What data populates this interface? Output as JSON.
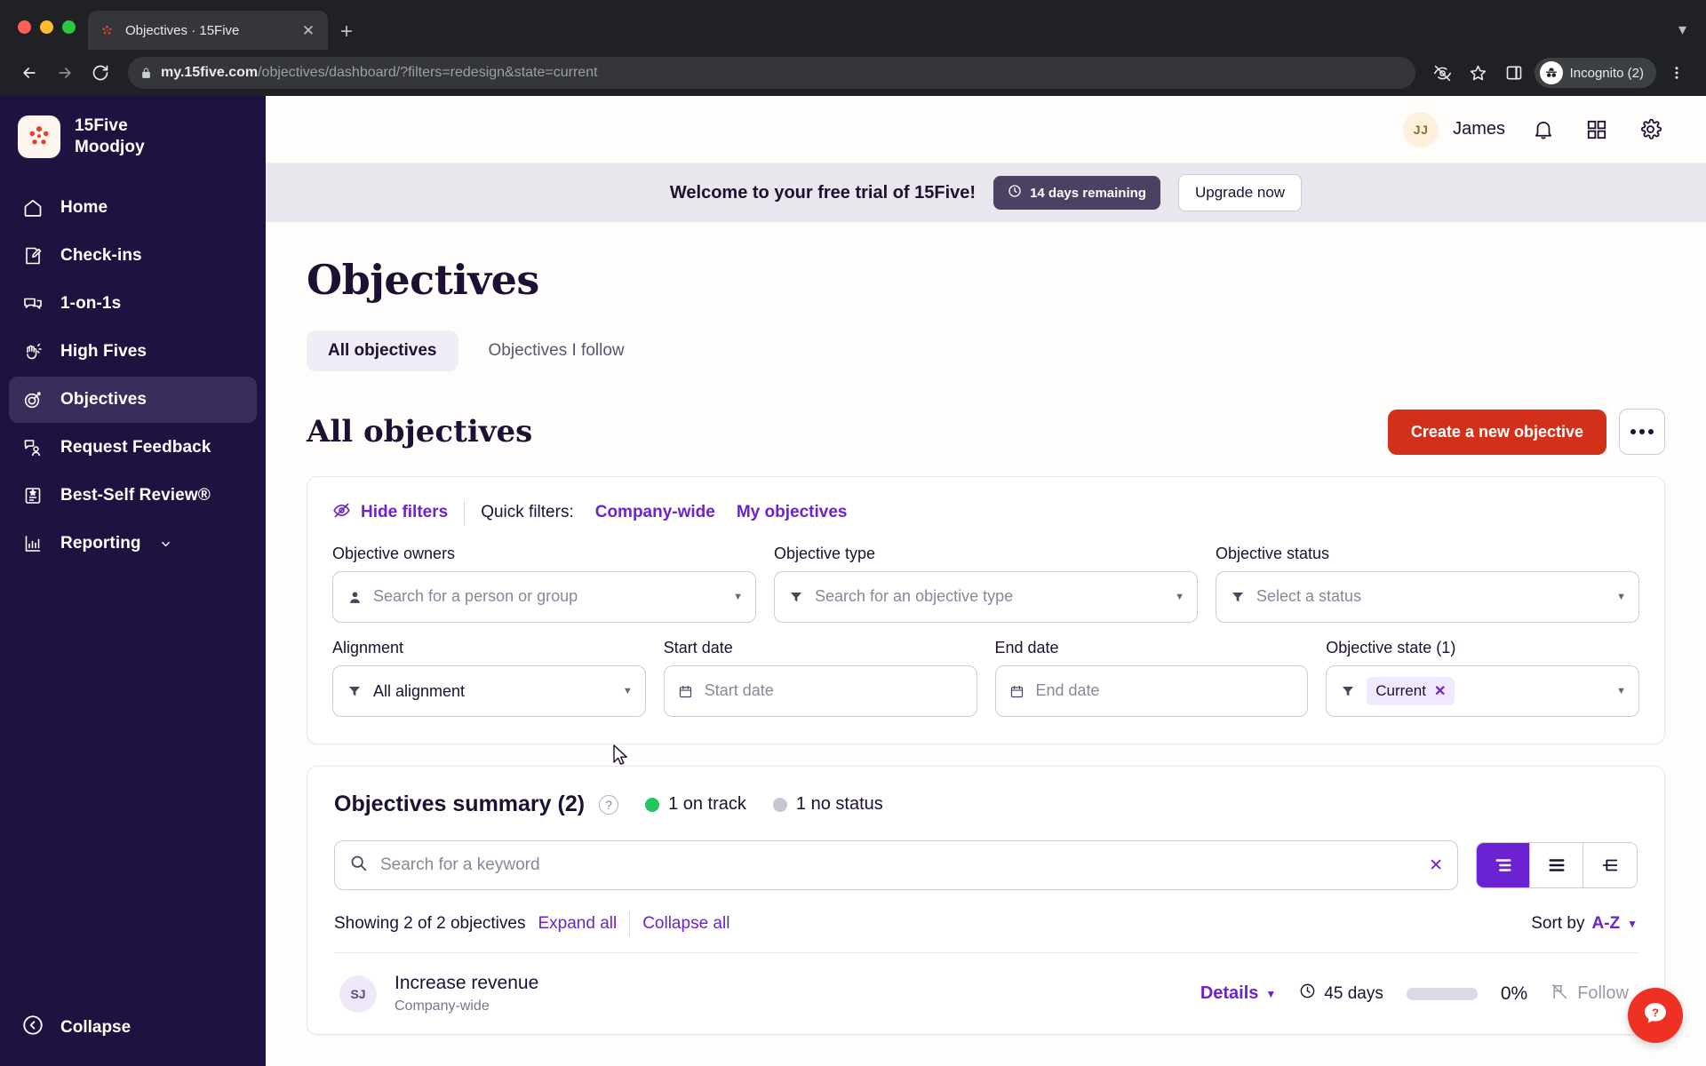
{
  "browser": {
    "tab": {
      "title": "Objectives · 15Five",
      "favicon_icon": "15five-logo-icon",
      "close_icon": "close-icon"
    },
    "new_tab_icon": "plus-icon",
    "tab_list_icon": "chevron-down-icon",
    "nav": {
      "back_icon": "back-arrow-icon",
      "forward_icon": "forward-arrow-icon",
      "reload_icon": "reload-icon"
    },
    "omnibox": {
      "lock_icon": "lock-icon",
      "url_host": "my.15five.com",
      "url_path": "/objectives/dashboard/?filters=redesign&state=current"
    },
    "right_icons": [
      "eye-slash-icon",
      "star-icon",
      "side-panel-icon"
    ],
    "profile": {
      "label": "Incognito (2)",
      "icon": "incognito-icon"
    },
    "menu_icon": "kebab-menu-icon"
  },
  "sidebar": {
    "brand": {
      "company": "15Five",
      "workspace": "Moodjoy",
      "logo_icon": "15five-logo-icon"
    },
    "items": [
      {
        "label": "Home",
        "icon": "home-icon",
        "active": false
      },
      {
        "label": "Check-ins",
        "icon": "checkin-pencil-icon",
        "active": false
      },
      {
        "label": "1-on-1s",
        "icon": "chat-bubbles-icon",
        "active": false
      },
      {
        "label": "High Fives",
        "icon": "high-five-hand-icon",
        "active": false
      },
      {
        "label": "Objectives",
        "icon": "target-arrow-icon",
        "active": true
      },
      {
        "label": "Request Feedback",
        "icon": "feedback-person-icon",
        "active": false
      },
      {
        "label": "Best-Self Review®",
        "icon": "review-badge-icon",
        "active": false
      },
      {
        "label": "Reporting",
        "icon": "bar-chart-icon",
        "active": false,
        "caret": "chevron-down-icon"
      }
    ],
    "collapse": {
      "label": "Collapse",
      "icon": "collapse-left-icon"
    }
  },
  "topbar": {
    "user": {
      "initials": "JJ",
      "name": "James"
    },
    "icons": [
      {
        "name": "notifications-bell-icon"
      },
      {
        "name": "apps-grid-icon"
      },
      {
        "name": "settings-gear-icon"
      }
    ]
  },
  "trial_banner": {
    "message": "Welcome to your free trial of 15Five!",
    "days_pill": {
      "label": "14 days remaining",
      "icon": "clock-icon"
    },
    "upgrade_label": "Upgrade now"
  },
  "page": {
    "title": "Objectives",
    "tabs": [
      {
        "label": "All objectives",
        "active": true
      },
      {
        "label": "Objectives I follow",
        "active": false
      }
    ],
    "section_title": "All objectives",
    "create_label": "Create a new objective",
    "more_icon": "ellipsis-icon"
  },
  "filters": {
    "hide_filters_label": "Hide filters",
    "hide_filters_icon": "eye-slash-icon",
    "quick_filters_label": "Quick filters:",
    "quick_links": [
      {
        "label": "Company-wide"
      },
      {
        "label": "My objectives"
      }
    ],
    "fields": [
      {
        "label": "Objective owners",
        "placeholder": "Search for a person or group",
        "icon": "person-icon",
        "name": "objective-owners"
      },
      {
        "label": "Objective type",
        "placeholder": "Search for an objective type",
        "icon": "funnel-icon",
        "name": "objective-type"
      },
      {
        "label": "Objective status",
        "placeholder": "Select a status",
        "icon": "funnel-icon",
        "name": "objective-status"
      },
      {
        "label": "Alignment",
        "value": "All alignment",
        "icon": "funnel-icon",
        "name": "alignment"
      },
      {
        "label": "Start date",
        "placeholder": "Start date",
        "icon": "calendar-icon",
        "name": "start-date"
      },
      {
        "label": "End date",
        "placeholder": "End date",
        "icon": "calendar-icon",
        "name": "end-date"
      },
      {
        "label": "Objective state (1)",
        "chip": "Current",
        "icon": "funnel-icon",
        "name": "objective-state"
      }
    ]
  },
  "summary": {
    "title": "Objectives summary (2)",
    "help_icon": "question-mark-icon",
    "stats": [
      {
        "label": "1 on track",
        "color": "#22c55e"
      },
      {
        "label": "1 no status",
        "color": "#c9c6d4"
      }
    ],
    "search_placeholder": "Search for a keyword",
    "search_value": "",
    "search_icon": "search-icon",
    "search_clear_icon": "clear-x-icon",
    "views": [
      {
        "name": "tree-view",
        "active": true
      },
      {
        "name": "list-view",
        "active": false
      },
      {
        "name": "hierarchy-view",
        "active": false
      }
    ],
    "showing_text": "Showing 2 of 2 objectives",
    "expand_all": "Expand all",
    "collapse_all": "Collapse all",
    "sort_label": "Sort by",
    "sort_value": "A-Z"
  },
  "objectives": [
    {
      "initials": "SJ",
      "name": "Increase revenue",
      "subtitle": "Company-wide",
      "details_label": "Details",
      "days": "45 days",
      "days_icon": "clock-icon",
      "progress": "0%",
      "progress_value": 0,
      "follow_label": "Follow",
      "follow_icon": "follow-flag-icon"
    }
  ],
  "help_fab": {
    "icon": "question-chat-icon"
  },
  "colors": {
    "brand_red": "#d3301a",
    "accent_purple": "#6b23d1",
    "sidebar_bg": "#1e1240",
    "on_track_green": "#22c55e",
    "no_status_grey": "#c9c6d4",
    "help_red": "#ef3124"
  }
}
